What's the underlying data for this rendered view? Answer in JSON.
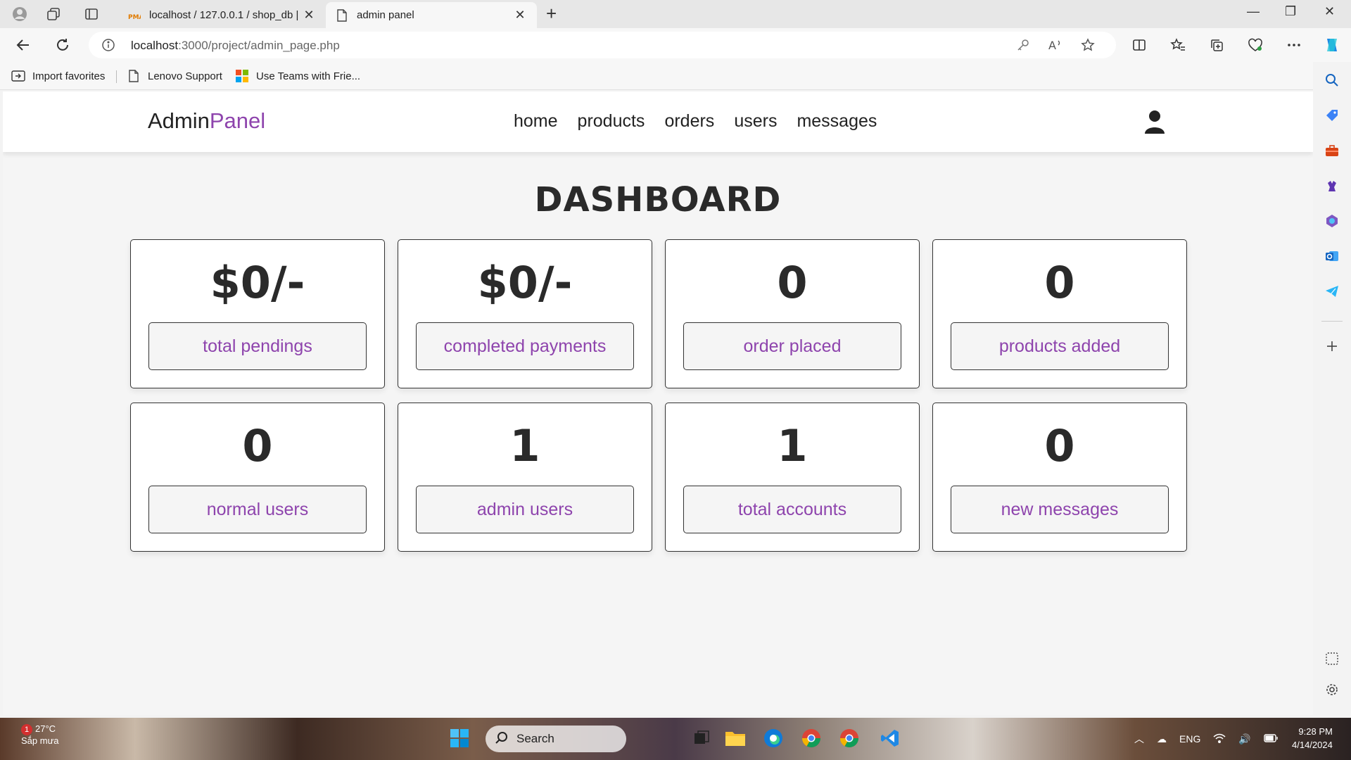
{
  "browser": {
    "tabs": [
      {
        "title": "localhost / 127.0.0.1 / shop_db | ",
        "active": false
      },
      {
        "title": "admin panel",
        "active": true
      }
    ],
    "url_host": "localhost",
    "url_path": ":3000/project/admin_page.php",
    "favorites": [
      "Import favorites",
      "Lenovo Support",
      "Use Teams with Frie..."
    ]
  },
  "header": {
    "logo_main": "Admin",
    "logo_accent": "Panel",
    "nav": [
      "home",
      "products",
      "orders",
      "users",
      "messages"
    ]
  },
  "dashboard": {
    "title": "DASHBOARD",
    "cards": [
      {
        "value": "$0/-",
        "label": "total pendings"
      },
      {
        "value": "$0/-",
        "label": "completed payments"
      },
      {
        "value": "0",
        "label": "order placed"
      },
      {
        "value": "0",
        "label": "products added"
      },
      {
        "value": "0",
        "label": "normal users"
      },
      {
        "value": "1",
        "label": "admin users"
      },
      {
        "value": "1",
        "label": "total accounts"
      },
      {
        "value": "0",
        "label": "new messages"
      }
    ]
  },
  "taskbar": {
    "weather_badge": "1",
    "weather_temp": "27°C",
    "weather_desc": "Sắp mưa",
    "search_label": "Search",
    "lang": "ENG",
    "time": "9:28 PM",
    "date": "4/14/2024"
  },
  "colors": {
    "accent": "#8e44ad",
    "text_dark": "#2a2a2a"
  }
}
